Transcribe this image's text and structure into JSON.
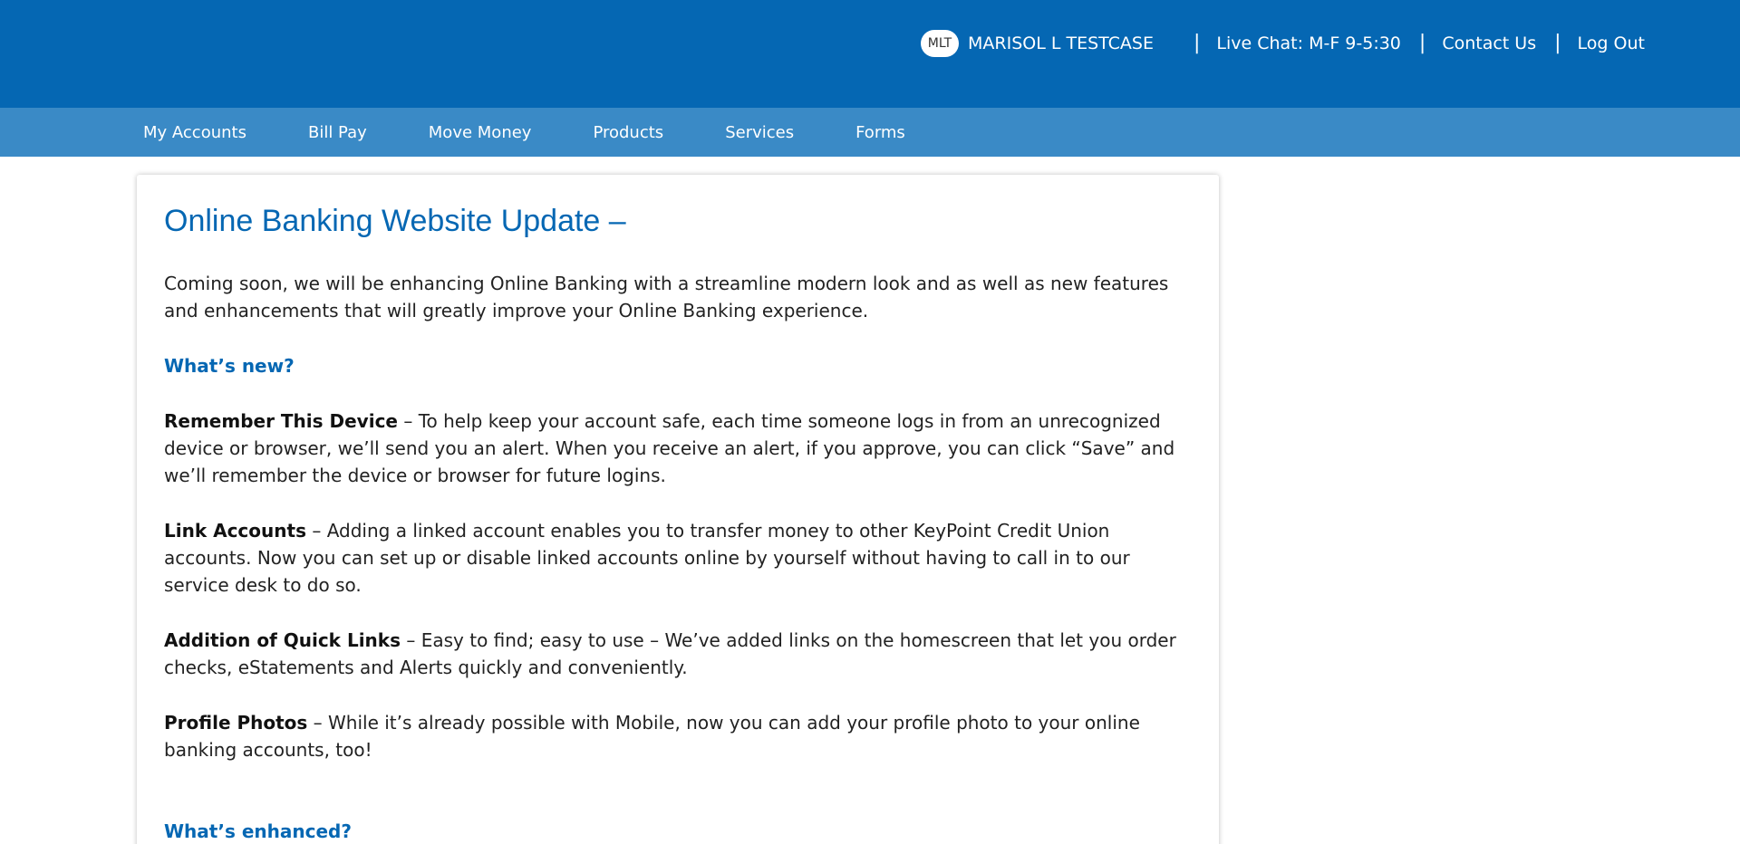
{
  "header": {
    "avatar_initials": "MLT",
    "user_name": "MARISOL L TESTCASE",
    "separator": "|",
    "live_chat": "Live Chat: M-F 9-5:30",
    "contact_us": "Contact Us",
    "log_out": "Log Out",
    "colors": {
      "primary": "#0567b3",
      "nav": "#3a8ac6"
    }
  },
  "nav": {
    "items": [
      {
        "label": "My Accounts"
      },
      {
        "label": "Bill Pay"
      },
      {
        "label": "Move Money"
      },
      {
        "label": "Products"
      },
      {
        "label": "Services"
      },
      {
        "label": "Forms"
      }
    ]
  },
  "content": {
    "title": "Online Banking Website Update –",
    "intro": "Coming soon, we will be enhancing Online Banking with a streamline modern look and as well as new features and enhancements that will greatly improve your Online Banking experience.",
    "whats_new_heading": "What’s new?",
    "features": [
      {
        "name": "Remember This Device",
        "text": " – To help keep your account safe, each time someone logs in from an unrecognized device or browser, we’ll send you an alert. When you receive an alert, if you approve, you can click “Save” and we’ll remember the device or browser for future logins."
      },
      {
        "name": "Link Accounts",
        "text": " – Adding a linked account enables you to transfer money to other KeyPoint Credit Union accounts. Now you can set up or disable linked accounts online by yourself without having to call in to our service desk to do so."
      },
      {
        "name": "Addition of Quick Links",
        "text": " – Easy to find; easy to use – We’ve added links on the homescreen that let you order checks, eStatements and Alerts quickly and conveniently."
      },
      {
        "name": "Profile Photos",
        "text": " – While it’s already possible with Mobile, now you can add your profile photo to your online banking accounts, too!"
      }
    ],
    "whats_enhanced_heading": "What’s enhanced?"
  }
}
